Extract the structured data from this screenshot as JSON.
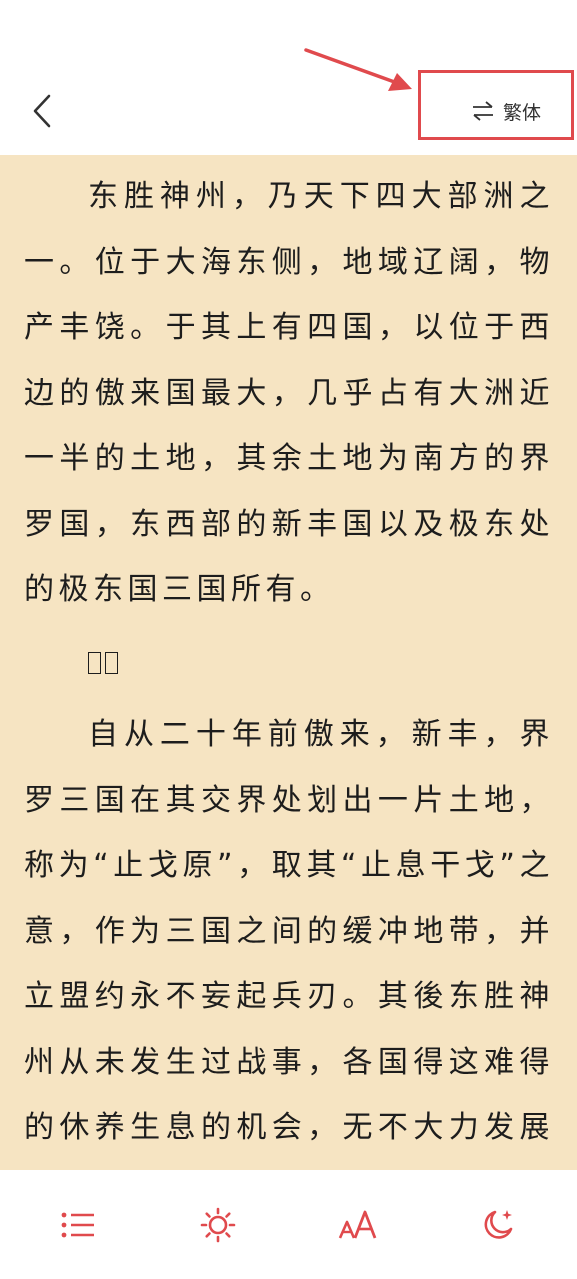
{
  "header": {
    "back_icon": "chevron-left-icon",
    "convert_icon": "swap-arrows-icon",
    "convert_label": "繁体"
  },
  "content": {
    "paragraphs": [
      "东胜神州，乃天下四大部洲之一。位于大海东侧，地域辽阔，物产丰饶。于其上有四国，以位于西边的傲来国最大，几乎占有大洲近一半的土地，其余土地为南方的界罗国，东西部的新丰国以及极东处的极东国三国所有。",
      "自从二十年前傲来，新丰，界罗三国在其交界处划出一片土地，称为“止戈原”，取其“止息干戈”之意，作为三国之间的缓冲地带，并立盟约永不妄起兵刃。其後东胜神州从未发生过战事，各国得这难得的休养生息的机会，无不大力发展农商，开山恳田，广纳贤才，以图增进国力。人民更"
    ]
  },
  "toolbar": {
    "items": [
      {
        "name": "catalog",
        "icon": "list-icon"
      },
      {
        "name": "brightness",
        "icon": "sun-icon"
      },
      {
        "name": "font-size",
        "icon": "font-size-icon"
      },
      {
        "name": "night-mode",
        "icon": "moon-star-icon"
      }
    ]
  },
  "colors": {
    "accent": "#e04a4d",
    "page_background": "#f6e4c2",
    "text": "#1d1d1d"
  }
}
